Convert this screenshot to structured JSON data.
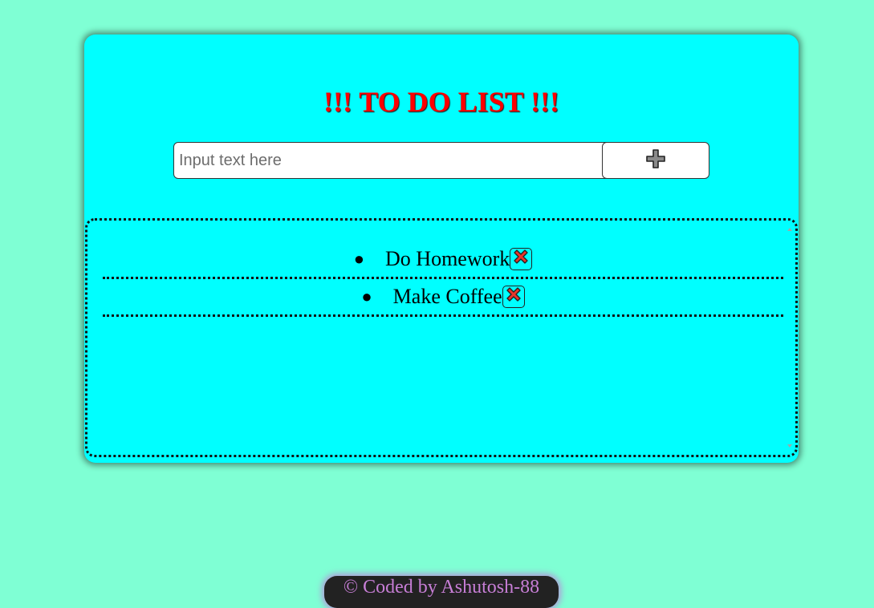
{
  "header": {
    "title": "!!! TO DO LIST !!!"
  },
  "input": {
    "placeholder": "Input text here",
    "value": ""
  },
  "add_button": {
    "icon": "plus-icon"
  },
  "todos": [
    {
      "label": "Do Homework",
      "delete_icon": "close-x-icon"
    },
    {
      "label": "Make Coffee",
      "delete_icon": "close-x-icon"
    }
  ],
  "footer": {
    "text": "© Coded by Ashutosh-88"
  },
  "colors": {
    "background": "#7fffd4",
    "card": "#00ffff",
    "title": "#ff0000",
    "delete_icon": "#e8352a",
    "footer_bg": "#222222",
    "footer_text": "#c77ed6"
  }
}
